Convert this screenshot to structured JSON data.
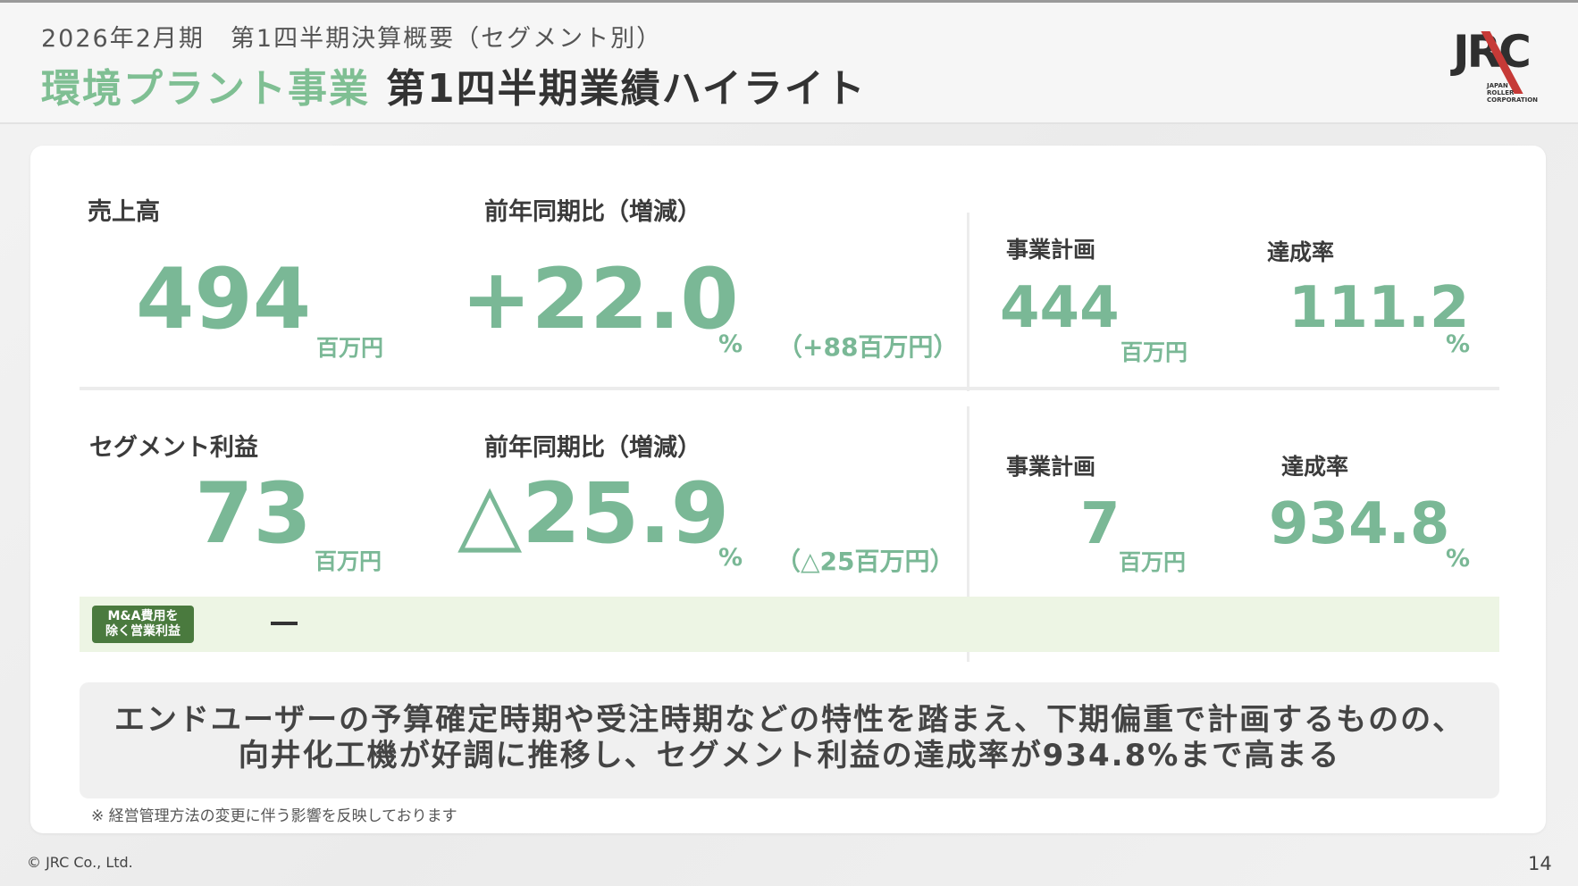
{
  "header": {
    "subtitle": "2026年2月期　第1四半期決算概要（セグメント別）",
    "title_accent": "環境プラント事業",
    "title_main": "第1四半期業績ハイライト"
  },
  "logo": {
    "word": "JRC",
    "line1": "JAPAN",
    "line2": "ROLLER",
    "line3": "CORPORATION"
  },
  "sales": {
    "label": "売上高",
    "value": "494",
    "unit": "百万円",
    "yoy_label": "前年同期比（増減）",
    "yoy_value": "+22.0",
    "yoy_pct": "%",
    "yoy_diff": "（+88百万円）",
    "plan_label": "事業計画",
    "plan_value": "444",
    "plan_unit": "百万円",
    "rate_label": "達成率",
    "rate_value": "111.2",
    "rate_pct": "%"
  },
  "profit": {
    "label": "セグメント利益",
    "value": "73",
    "unit": "百万円",
    "yoy_label": "前年同期比（増減）",
    "yoy_value": "△25.9",
    "yoy_pct": "%",
    "yoy_diff": "（△25百万円）",
    "plan_label": "事業計画",
    "plan_value": "7",
    "plan_unit": "百万円",
    "rate_label": "達成率",
    "rate_value": "934.8",
    "rate_pct": "%"
  },
  "ma_row": {
    "badge_line1": "M&A費用を",
    "badge_line2": "除く営業利益"
  },
  "summary": {
    "line1": "エンドユーザーの予算確定時期や受注時期などの特性を踏まえ、下期偏重で計画するものの、",
    "line2": "向井化工機が好調に推移し、セグメント利益の達成率が934.8%まで高まる"
  },
  "note": "※ 経営管理方法の変更に伴う影響を反映しております",
  "footer": {
    "copyright": "© JRC Co., Ltd.",
    "page": "14"
  },
  "colors": {
    "accent_green": "#7ab896",
    "title_green": "#7fbf93",
    "badge_green": "#4a7a3e",
    "row_highlight": "#edf5e4",
    "logo_red": "#c63a37"
  }
}
